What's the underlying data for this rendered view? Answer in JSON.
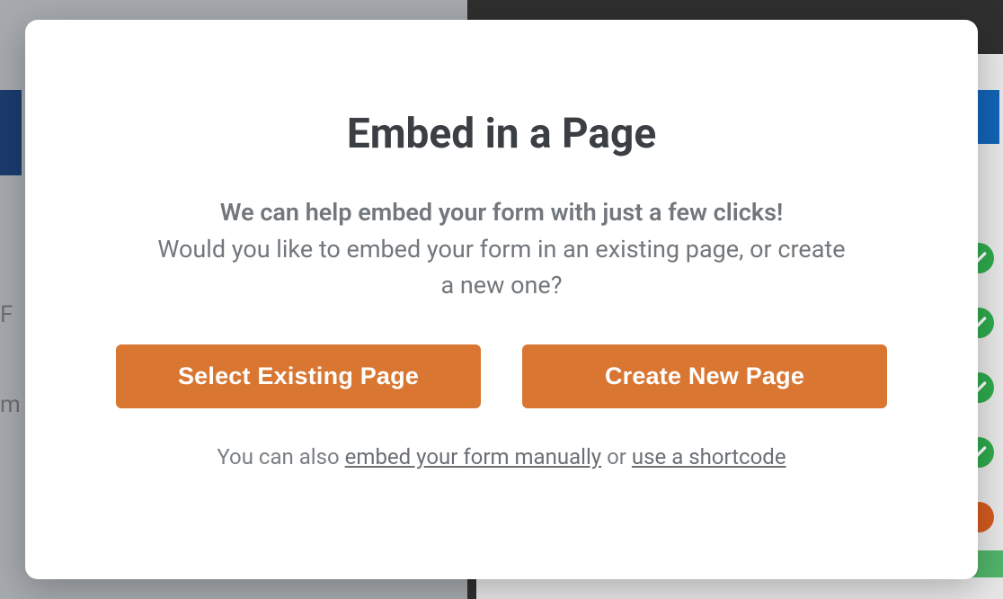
{
  "modal": {
    "title": "Embed in a Page",
    "subtitle_bold": "We can help embed your form with just a few clicks!",
    "subtitle_regular": "Would you like to embed your form in an existing page, or create a new one?",
    "buttons": {
      "existing": "Select Existing Page",
      "new": "Create New Page"
    },
    "footer": {
      "prefix": "You can also ",
      "link_manual": "embed your form manually",
      "middle": " or ",
      "link_shortcode": "use a shortcode"
    }
  },
  "background": {
    "left_text_1": "F",
    "left_text_2": "m"
  }
}
